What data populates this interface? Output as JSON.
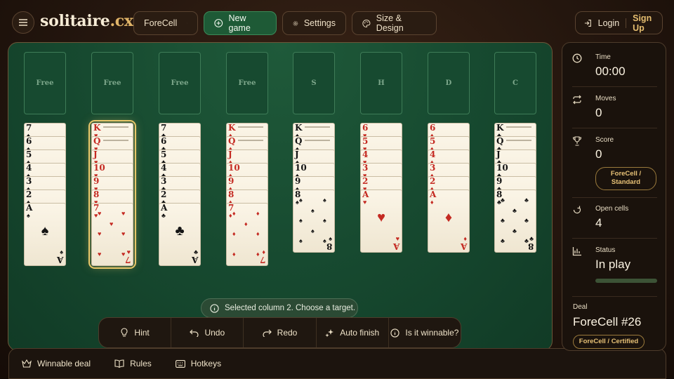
{
  "header": {
    "logo_main": "solitaire",
    "logo_tld": ".cx",
    "variant_select": "ForeCell",
    "new_game": "New game",
    "settings": "Settings",
    "size_design": "Size & Design",
    "login": "Login",
    "signup": "Sign Up"
  },
  "slots": [
    {
      "label": "Free"
    },
    {
      "label": "Free"
    },
    {
      "label": "Free"
    },
    {
      "label": "Free"
    },
    {
      "label": "S"
    },
    {
      "label": "H"
    },
    {
      "label": "D"
    },
    {
      "label": "C"
    }
  ],
  "columns": [
    {
      "selected": false,
      "cards": [
        {
          "r": "7",
          "s": "♠"
        },
        {
          "r": "6",
          "s": "♠"
        },
        {
          "r": "5",
          "s": "♠"
        },
        {
          "r": "4",
          "s": "♠"
        },
        {
          "r": "3",
          "s": "♠"
        },
        {
          "r": "2",
          "s": "♠"
        },
        {
          "r": "A",
          "s": "♠"
        }
      ]
    },
    {
      "selected": true,
      "cards": [
        {
          "r": "K",
          "s": "♥"
        },
        {
          "r": "Q",
          "s": "♥"
        },
        {
          "r": "J",
          "s": "♥"
        },
        {
          "r": "10",
          "s": "♥"
        },
        {
          "r": "9",
          "s": "♥"
        },
        {
          "r": "8",
          "s": "♥"
        },
        {
          "r": "7",
          "s": "♥"
        }
      ]
    },
    {
      "selected": false,
      "cards": [
        {
          "r": "7",
          "s": "♣"
        },
        {
          "r": "6",
          "s": "♣"
        },
        {
          "r": "5",
          "s": "♣"
        },
        {
          "r": "4",
          "s": "♣"
        },
        {
          "r": "3",
          "s": "♣"
        },
        {
          "r": "2",
          "s": "♣"
        },
        {
          "r": "A",
          "s": "♣"
        }
      ]
    },
    {
      "selected": false,
      "cards": [
        {
          "r": "K",
          "s": "♦"
        },
        {
          "r": "Q",
          "s": "♦"
        },
        {
          "r": "J",
          "s": "♦"
        },
        {
          "r": "10",
          "s": "♦"
        },
        {
          "r": "9",
          "s": "♦"
        },
        {
          "r": "8",
          "s": "♦"
        },
        {
          "r": "7",
          "s": "♦"
        }
      ]
    },
    {
      "selected": false,
      "cards": [
        {
          "r": "K",
          "s": "♠"
        },
        {
          "r": "Q",
          "s": "♠"
        },
        {
          "r": "J",
          "s": "♠"
        },
        {
          "r": "10",
          "s": "♠"
        },
        {
          "r": "9",
          "s": "♠"
        },
        {
          "r": "8",
          "s": "♠"
        }
      ]
    },
    {
      "selected": false,
      "cards": [
        {
          "r": "6",
          "s": "♥"
        },
        {
          "r": "5",
          "s": "♥"
        },
        {
          "r": "4",
          "s": "♥"
        },
        {
          "r": "3",
          "s": "♥"
        },
        {
          "r": "2",
          "s": "♥"
        },
        {
          "r": "A",
          "s": "♥"
        }
      ]
    },
    {
      "selected": false,
      "cards": [
        {
          "r": "6",
          "s": "♦"
        },
        {
          "r": "5",
          "s": "♦"
        },
        {
          "r": "4",
          "s": "♦"
        },
        {
          "r": "3",
          "s": "♦"
        },
        {
          "r": "2",
          "s": "♦"
        },
        {
          "r": "A",
          "s": "♦"
        }
      ]
    },
    {
      "selected": false,
      "cards": [
        {
          "r": "K",
          "s": "♣"
        },
        {
          "r": "Q",
          "s": "♣"
        },
        {
          "r": "J",
          "s": "♣"
        },
        {
          "r": "10",
          "s": "♣"
        },
        {
          "r": "9",
          "s": "♣"
        },
        {
          "r": "8",
          "s": "♣"
        }
      ]
    }
  ],
  "toast": "Selected column 2. Choose a target.",
  "actions": {
    "hint": "Hint",
    "undo": "Undo",
    "redo": "Redo",
    "auto_finish": "Auto finish",
    "winnable": "Is it winnable?"
  },
  "bottom": {
    "winnable_deal": "Winnable deal",
    "rules": "Rules",
    "hotkeys": "Hotkeys"
  },
  "panel": {
    "time_label": "Time",
    "time_value": "00:00",
    "moves_label": "Moves",
    "moves_value": "0",
    "score_label": "Score",
    "score_value": "0",
    "score_badge_line1": "ForeCell /",
    "score_badge_line2": "Standard",
    "open_cells_label": "Open cells",
    "open_cells_value": "4",
    "status_label": "Status",
    "status_value": "In play",
    "status_progress": 0,
    "deal_label": "Deal",
    "deal_value": "ForeCell #26",
    "deal_badge": "ForeCell / Certified"
  },
  "colors": {
    "red_suit": "#c42a22",
    "black_suit": "#141414",
    "felt": "#174a30",
    "accent_gold": "#e6be70"
  }
}
